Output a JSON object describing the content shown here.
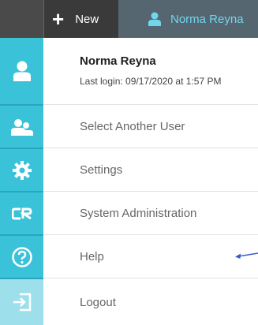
{
  "topbar": {
    "new_label": "New",
    "user_label": "Norma Reyna"
  },
  "user_card": {
    "name": "Norma Reyna",
    "last_login": "Last login: 09/17/2020 at 1:57 PM"
  },
  "menu": {
    "items": [
      {
        "label": "Select Another User",
        "icon": "users-icon"
      },
      {
        "label": "Settings",
        "icon": "gear-icon"
      },
      {
        "label": "System Administration",
        "icon": "cr-logo-icon"
      },
      {
        "label": "Help",
        "icon": "help-icon"
      },
      {
        "label": "Logout",
        "icon": "logout-icon"
      }
    ]
  },
  "colors": {
    "rail": "#39c2d8",
    "rail_light": "#9de0ec",
    "topbar": "#3a3a3a",
    "user_button": "#566670",
    "user_text": "#6fd6ec",
    "annotation_arrow": "#3b5bcc"
  }
}
